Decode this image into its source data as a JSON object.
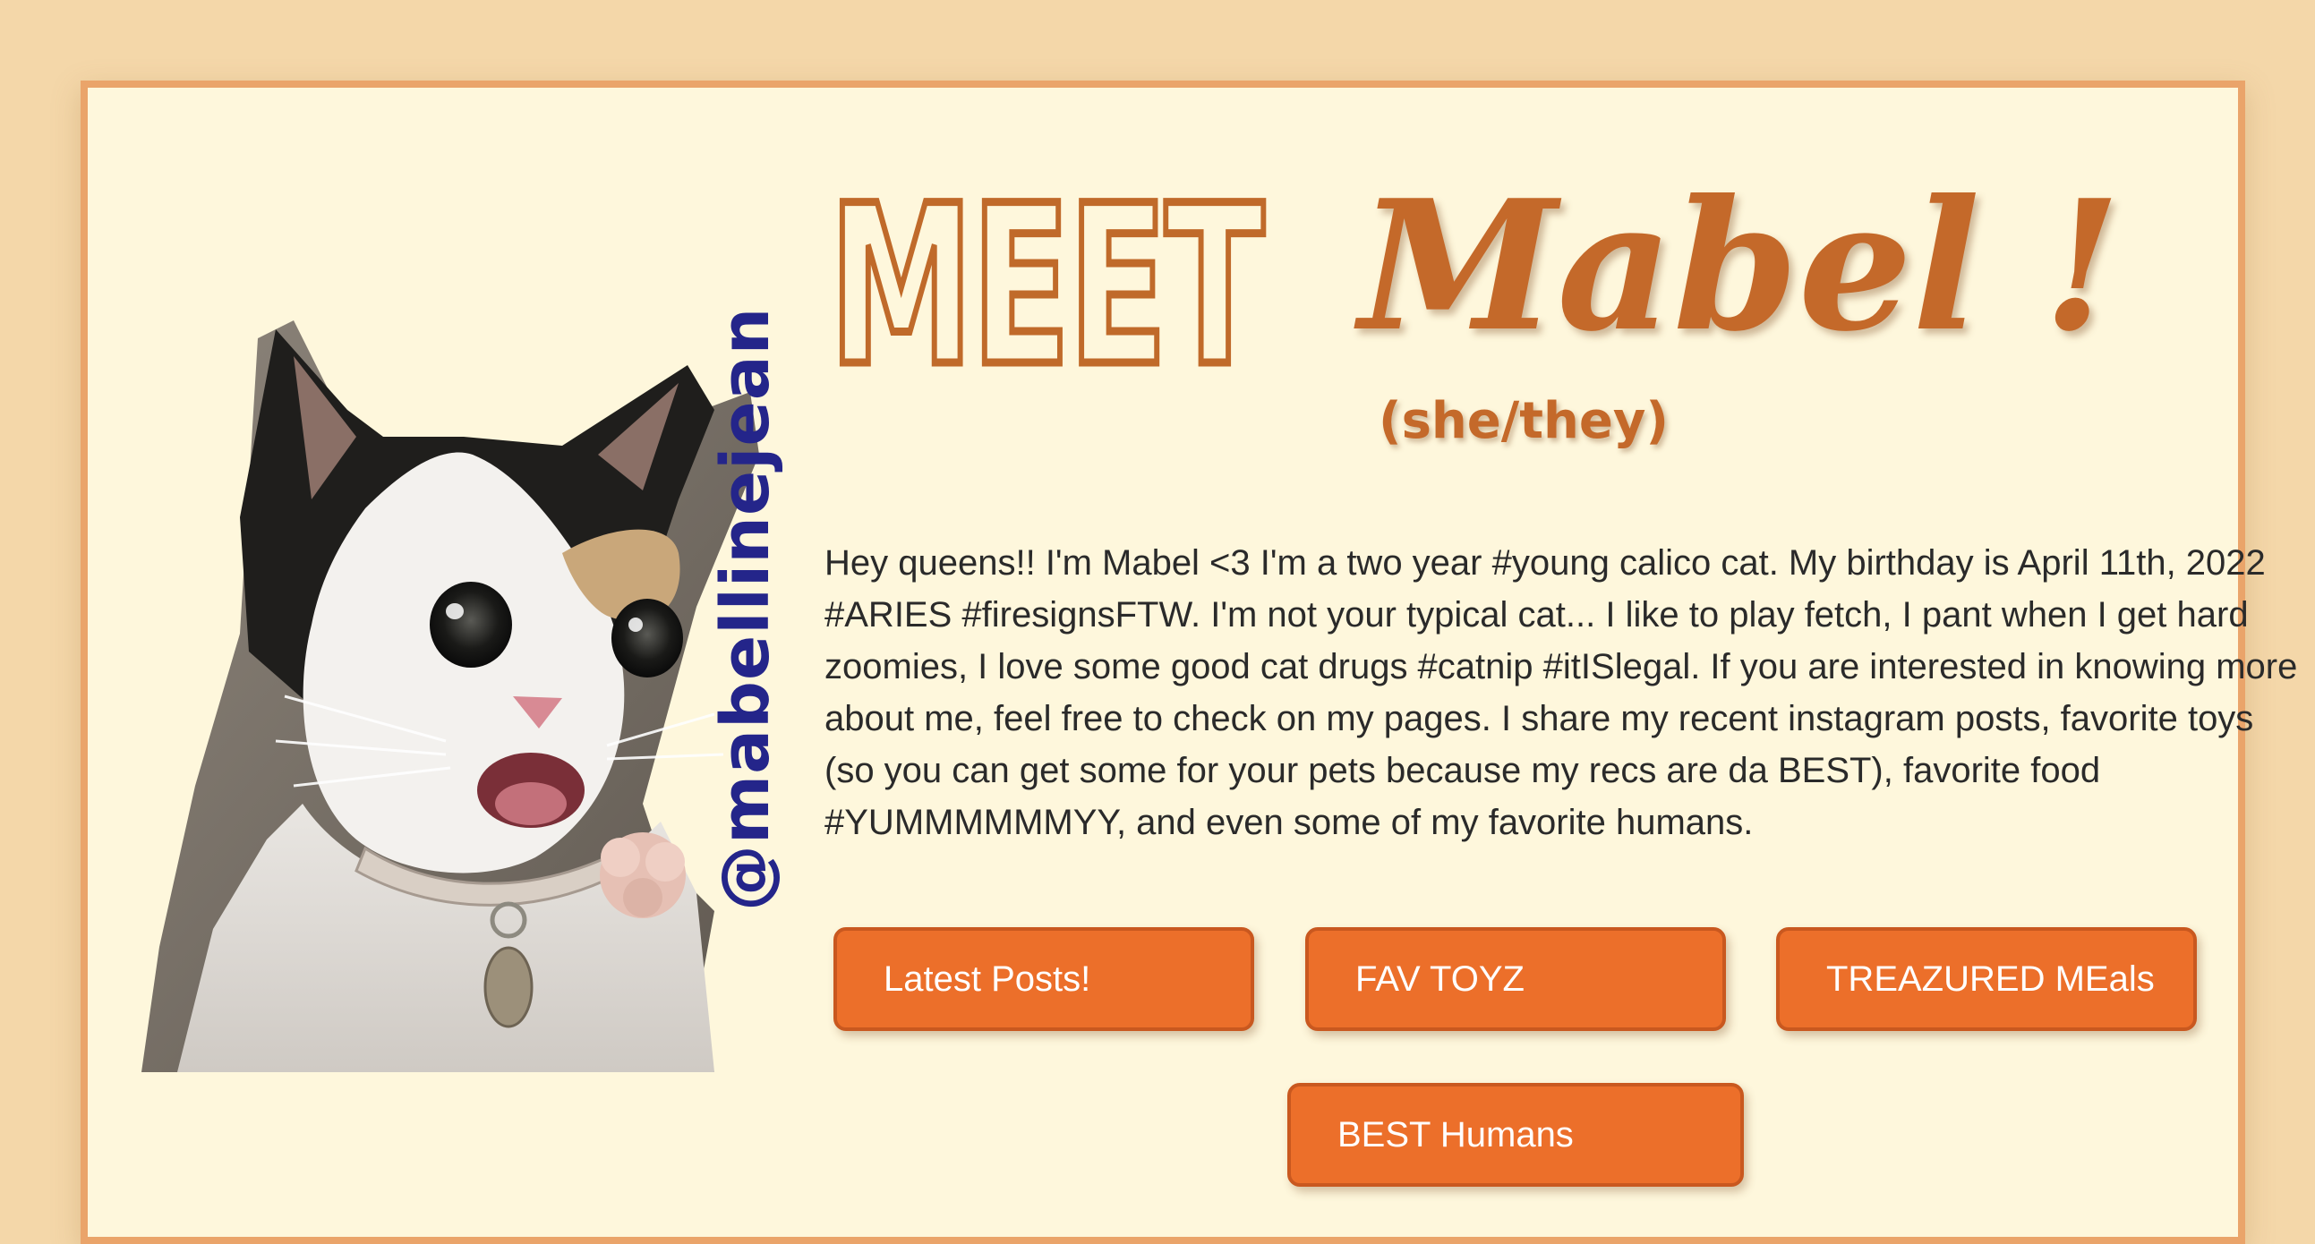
{
  "profile": {
    "handle": "@mabellinejean",
    "heading_word": "MEET",
    "name": "Mabel !",
    "pronouns": "(she/they)",
    "bio": "Hey queens!! I'm Mabel <3 I'm a two year #young calico cat. My birthday is April 11th, 2022 #ARIES #firesignsFTW. I'm not your typical cat... I like to play fetch, I pant when I get hard zoomies, I love some good cat drugs #catnip #itISlegal. If you are interested in knowing more about me, feel free to check on my pages. I share my recent instagram posts, favorite toys (so you can get some for your pets because my recs are da BEST), favorite food #YUMMMMMMYY, and even some of my favorite humans."
  },
  "nav": {
    "latest_posts": "Latest Posts!",
    "fav_toyz": "FAV TOYZ",
    "treazured_meals": "TREAZURED MEals",
    "best_humans": "BEST Humans"
  },
  "colors": {
    "page_background": "#f4d7a9",
    "card_background": "#fef7dc",
    "card_border": "#eaa46a",
    "accent_orange": "#ec6f2a",
    "heading_brown": "#c4692a",
    "handle_blue": "#24258a"
  }
}
